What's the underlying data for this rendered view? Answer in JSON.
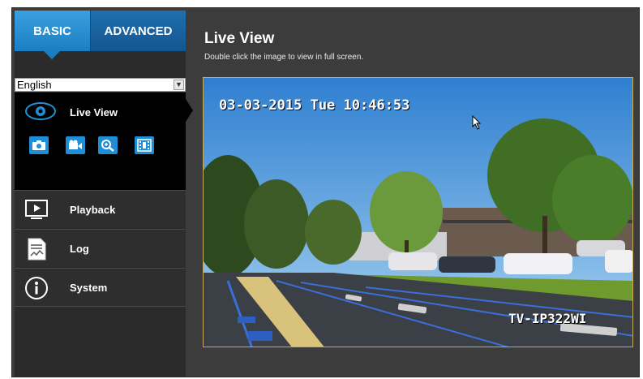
{
  "tabs": {
    "basic": "BASIC",
    "advanced": "ADVANCED"
  },
  "language": {
    "selected": "English"
  },
  "sidebar": {
    "live_view": "Live View",
    "tools": [
      {
        "icon": "snapshot-icon"
      },
      {
        "icon": "record-icon"
      },
      {
        "icon": "zoom-icon"
      },
      {
        "icon": "frame-icon"
      }
    ],
    "items": [
      {
        "label": "Playback",
        "icon": "playback-icon"
      },
      {
        "label": "Log",
        "icon": "log-icon"
      },
      {
        "label": "System",
        "icon": "info-icon"
      }
    ]
  },
  "main": {
    "title": "Live View",
    "subtitle": "Double click the image to view in full screen."
  },
  "video": {
    "timestamp": "03-03-2015 Tue 10:46:53",
    "camera_name": "TV-IP322WI"
  },
  "colors": {
    "accent": "#1e8fd6",
    "sidebar": "#2b2b2b",
    "background": "#3c3c3c"
  }
}
